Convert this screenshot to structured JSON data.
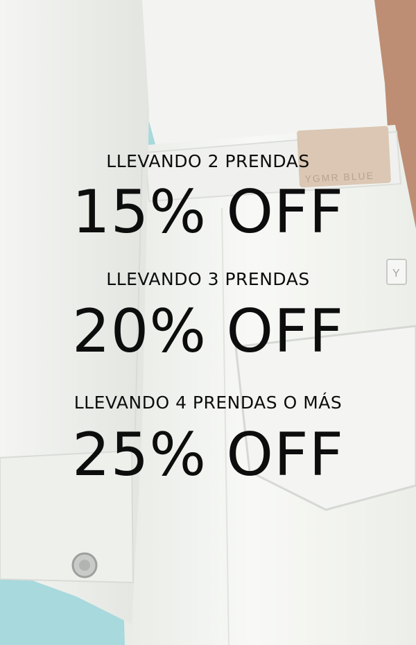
{
  "background": {
    "description_colors": {
      "sky": "#9fd6db",
      "fabric_light": "#f7f8f5",
      "fabric_shadow": "#dfe1dd",
      "skin": "#b88a70",
      "label_patch": "#d9c3ad"
    },
    "brand_patch_text": "YGMR BLUE",
    "rivet_letter": "Y"
  },
  "promo": {
    "tiers": [
      {
        "label": "LLEVANDO 2 PRENDAS",
        "value": "15% OFF"
      },
      {
        "label": "LLEVANDO 3 PRENDAS",
        "value": "20% OFF"
      },
      {
        "label": "LLEVANDO 4 PRENDAS O MÁS",
        "value": "25% OFF"
      }
    ]
  }
}
